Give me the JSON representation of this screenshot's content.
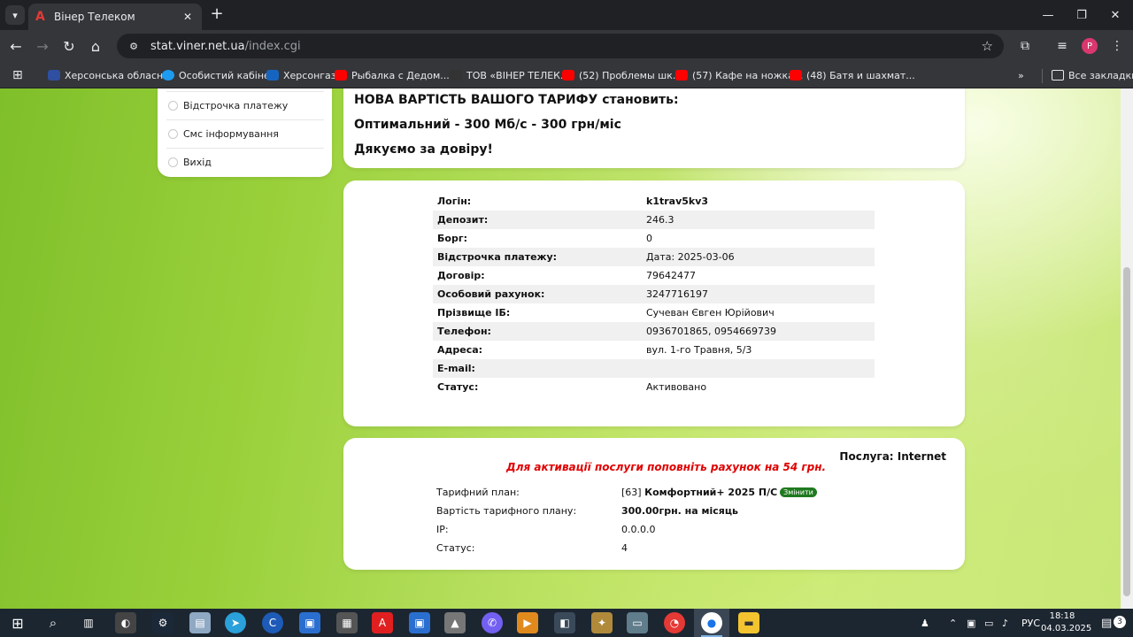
{
  "browser": {
    "tab_title": "Вінер Телеком",
    "url_host": "stat.viner.net.ua",
    "url_path": "/index.cgi",
    "profile_initial": "P",
    "bookmarks": [
      "Херсонська обласн...",
      "Особистий кабінет",
      "Херсонгаз",
      "Рыбалка с Дедом...",
      "ТОВ «ВІНЕР ТЕЛЕК...",
      "(52) Проблемы шк...",
      "(57) Кафе на ножка...",
      "(48) Батя и шахмат..."
    ],
    "all_bookmarks": "Все закладки",
    "colors": {
      "chrome_dark": "#202124",
      "chrome_mid": "#35363a",
      "profile": "#d9376e"
    }
  },
  "sidebar": {
    "items": [
      "Відстрочка платежу",
      "Смс інформування",
      "Вихід"
    ]
  },
  "notice": {
    "line1": "НОВА ВАРТІСТЬ ВАШОГО ТАРИФУ становить:",
    "line2": "Оптимальний - 300 Мб/с - 300 грн/міс",
    "line3": "Дякуємо за довіру!"
  },
  "account": {
    "rows": [
      {
        "label": "Логін:",
        "value": "k1trav5kv3",
        "bold": true
      },
      {
        "label": "Депозит:",
        "value": "246.3"
      },
      {
        "label": "Борг:",
        "value": "0"
      },
      {
        "label": "Відстрочка платежу:",
        "value": "Дата: 2025-03-06"
      },
      {
        "label": "Договір:",
        "value": "79642477"
      },
      {
        "label": "Особовий рахунок:",
        "value": "3247716197"
      },
      {
        "label": "Прізвище ІБ:",
        "value": "Сучеван Євген Юрійович"
      },
      {
        "label": "Телефон:",
        "value": "0936701865, 0954669739"
      },
      {
        "label": "Адреса:",
        "value": "вул. 1-го Травня, 5/3"
      },
      {
        "label": "E-mail:",
        "value": ""
      },
      {
        "label": "Статус:",
        "value": "Активовано"
      }
    ]
  },
  "service": {
    "name": "Послуга: Internet",
    "warning": "Для активації послуги поповніть рахунок на 54 грн.",
    "plan_label": "Тарифний план:",
    "plan_id": "[63]",
    "plan_name": "Комфортний+ 2025 П/С",
    "change_label": "Змінити",
    "price_label": "Вартість тарифного плану:",
    "price_value": "300.00грн. на місяць",
    "ip_label": "IP:",
    "ip_value": "0.0.0.0",
    "status_label": "Статус:",
    "status_value": "4",
    "warning_color": "#e00000",
    "badge_color": "#1f7a1f"
  },
  "taskbar": {
    "lang": "РУС",
    "time": "18:18",
    "date": "04.03.2025",
    "notifications": "3"
  }
}
